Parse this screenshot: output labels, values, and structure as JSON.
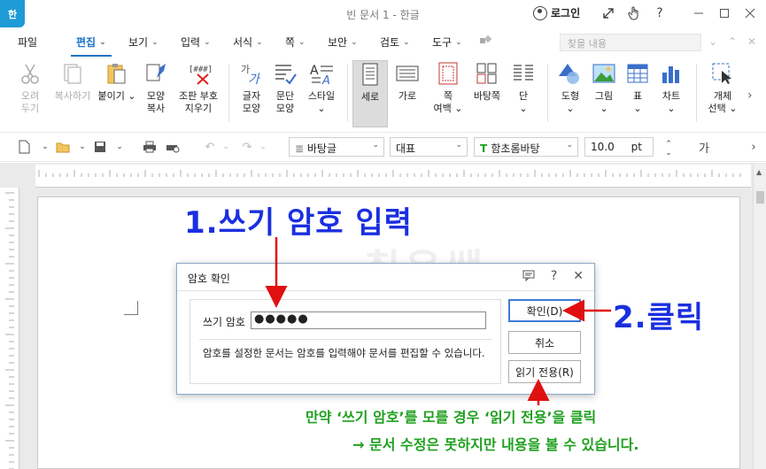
{
  "window": {
    "app_icon": "한",
    "title": "빈 문서 1 - 한글",
    "login_label": "로그인"
  },
  "menu": {
    "items": [
      "파일",
      "편집",
      "보기",
      "입력",
      "서식",
      "쪽",
      "보안",
      "검토",
      "도구"
    ],
    "active_index": 1,
    "find_placeholder": "찾을 내용"
  },
  "ribbon": {
    "buttons": [
      {
        "label": "오려\n두기",
        "icon": "scissors-icon",
        "disabled": true
      },
      {
        "label": "복사하기",
        "icon": "copy-icon",
        "disabled": true
      },
      {
        "label": "붙이기 ⌄",
        "icon": "paste-icon",
        "disabled": false
      },
      {
        "label": "모양\n복사",
        "icon": "format-painter-icon",
        "disabled": false
      },
      {
        "label": "조판 부호\n지우기",
        "icon": "clear-codes-icon",
        "disabled": false
      },
      {
        "label": "글자\n모양",
        "icon": "char-shape-icon",
        "disabled": false
      },
      {
        "label": "문단\n모양",
        "icon": "para-shape-icon",
        "disabled": false
      },
      {
        "label": "스타일\n⌄",
        "icon": "style-icon",
        "disabled": false
      },
      {
        "label": "세로",
        "icon": "portrait-icon",
        "disabled": false
      },
      {
        "label": "가로",
        "icon": "landscape-icon",
        "disabled": false
      },
      {
        "label": "쪽\n여백 ⌄",
        "icon": "margin-icon",
        "disabled": false
      },
      {
        "label": "바탕쪽",
        "icon": "master-page-icon",
        "disabled": false
      },
      {
        "label": "단\n⌄",
        "icon": "columns-icon",
        "disabled": false
      },
      {
        "label": "도형\n⌄",
        "icon": "shape-icon",
        "disabled": false
      },
      {
        "label": "그림\n⌄",
        "icon": "picture-icon",
        "disabled": false
      },
      {
        "label": "표\n⌄",
        "icon": "table-icon",
        "disabled": false
      },
      {
        "label": "차트\n⌄",
        "icon": "chart-icon",
        "disabled": false
      },
      {
        "label": "개체\n선택 ⌄",
        "icon": "select-object-icon",
        "disabled": false
      }
    ],
    "selected_index": 8
  },
  "format_bar": {
    "style": "바탕글",
    "language": "대표",
    "font": "함초롬바탕",
    "font_size": "10.0",
    "size_unit": "pt",
    "char_glyph": "가"
  },
  "document": {
    "watermark": "취운쌤"
  },
  "dialog": {
    "title": "암호 확인",
    "password_label": "쓰기 암호",
    "password_value": "●●●●●",
    "help_text": "암호를 설정한 문서는 암호를 입력해야 문서를 편집할 수 있습니다.",
    "confirm_label": "확인(D)",
    "cancel_label": "취소",
    "readonly_label": "읽기 전용(R)"
  },
  "annotations": {
    "step1": "1.쓰기 암호 입력",
    "step2": "2.클릭",
    "note_line1": "만약 ‘쓰기 암호’를 모를 경우 ‘읽기 전용’을 클릭",
    "note_line2": "→ 문서 수정은 못하지만 내용을 볼 수 있습니다."
  },
  "colors": {
    "accent": "#1a73c9",
    "annotation_blue": "#1a2fe0",
    "annotation_red": "#e01010",
    "annotation_green": "#1fa01f"
  }
}
